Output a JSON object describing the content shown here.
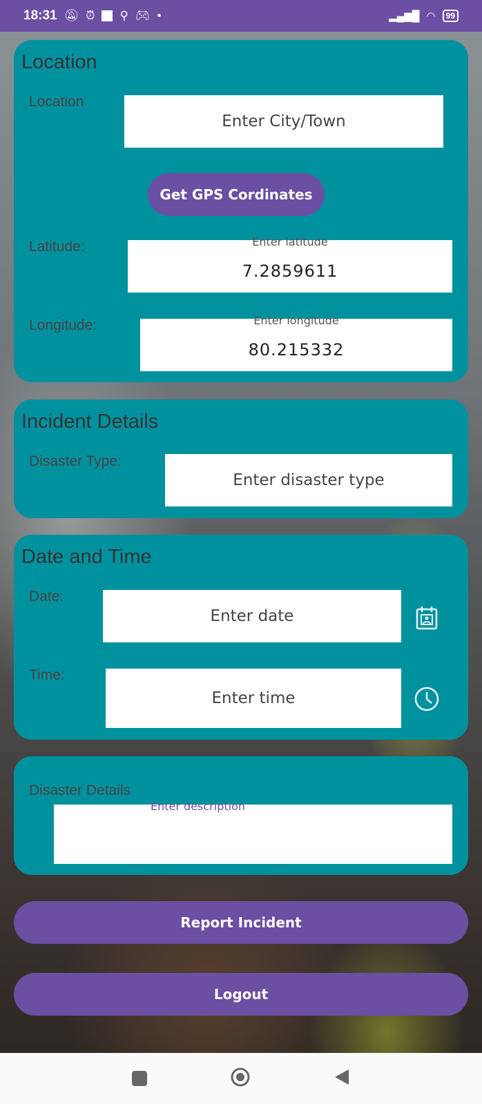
{
  "status_bar": {
    "time": "18:31",
    "battery": "99"
  },
  "location_card": {
    "title": "Location",
    "location_label": "Location",
    "location_placeholder": "Enter City/Town",
    "gps_button": "Get GPS Cordinates",
    "latitude_label": "Latitude:",
    "latitude_hint": "Enter latitude",
    "latitude_value": "7.2859611",
    "longitude_label": "Longitude:",
    "longitude_hint": "Enter longitude",
    "longitude_value": "80.215332"
  },
  "incident_card": {
    "title": "Incident Details",
    "disaster_type_label": "Disaster Type:",
    "disaster_type_placeholder": "Enter disaster type"
  },
  "datetime_card": {
    "title": "Date and Time",
    "date_label": "Date:",
    "date_placeholder": "Enter date",
    "time_label": "Time:",
    "time_placeholder": "Enter time"
  },
  "details_card": {
    "label": "Disaster Details",
    "description_hint": "Enter description"
  },
  "actions": {
    "report_button": "Report Incident",
    "logout_button": "Logout"
  },
  "colors": {
    "primary": "#6a4fa3",
    "card": "#00919f"
  }
}
